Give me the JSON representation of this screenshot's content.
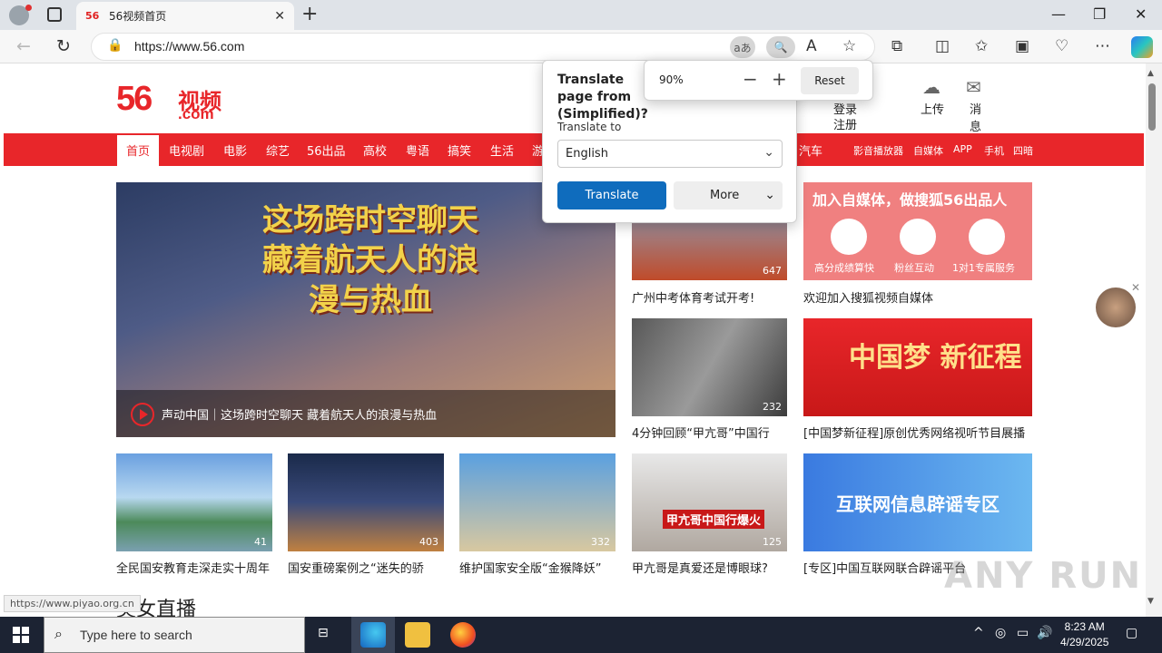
{
  "browser": {
    "tab_title": "56视频首页",
    "tab_favicon": "56",
    "url": "https://www.56.com",
    "translate_icon": "aあ"
  },
  "site": {
    "logo_num": "56",
    "logo_cn": "视频",
    "logo_com": ".com",
    "header": {
      "login": "登录",
      "register": "注册",
      "upload": "上传",
      "messages_1": "消",
      "messages_2": "息"
    },
    "nav": [
      "首页",
      "电视剧",
      "电影",
      "综艺",
      "56出品",
      "高校",
      "粤语",
      "搞笑",
      "生活",
      "游",
      "汽车",
      "影音播放器",
      "自媒体",
      "APP",
      "手机",
      "四暗"
    ],
    "hero": {
      "title": "这场跨时空聊天藏着航天人的浪漫与热血",
      "caption": "声动中国｜这场跨时空聊天 藏着航天人的浪漫与热血"
    },
    "tiles": [
      {
        "count": "647",
        "caption": "广州中考体育考试开考!"
      },
      {
        "banner": "加入自媒体，做搜狐56出品人",
        "labels": [
          "高分成绩算快",
          "粉丝互动",
          "1对1专属服务"
        ],
        "caption": "欢迎加入搜狐视频自媒体"
      },
      {
        "count": "232",
        "caption": "4分钟回顾“甲亢哥”中国行"
      },
      {
        "banner": "中国梦 新征程",
        "caption": "[中国梦新征程]原创优秀网络视听节目展播"
      },
      {
        "count": "41",
        "caption": "全民国安教育走深走实十周年"
      },
      {
        "count": "403",
        "caption": "国安重磅案例之“迷失的骄"
      },
      {
        "count": "332",
        "caption": "维护国家安全版“金猴降妖”"
      },
      {
        "count": "125",
        "banner": "甲亢哥中国行爆火",
        "caption": "甲亢哥是真爱还是博眼球?"
      },
      {
        "banner": "互联网信息辟谣专区",
        "caption": "[专区]中国互联网联合辟谣平台"
      }
    ],
    "section_title": "美女直播",
    "status_url": "https://www.piyao.org.cn"
  },
  "translate_popup": {
    "title": "Translate page from (Simplified)?",
    "translate_to_label": "Translate to",
    "language": "English",
    "translate_button": "Translate",
    "more_button": "More"
  },
  "zoom_popup": {
    "value": "90%",
    "minus": "−",
    "plus": "+",
    "reset": "Reset"
  },
  "watermark": "ANY RUN",
  "taskbar": {
    "search_placeholder": "Type here to search",
    "time": "8:23 AM",
    "date": "4/29/2025"
  }
}
